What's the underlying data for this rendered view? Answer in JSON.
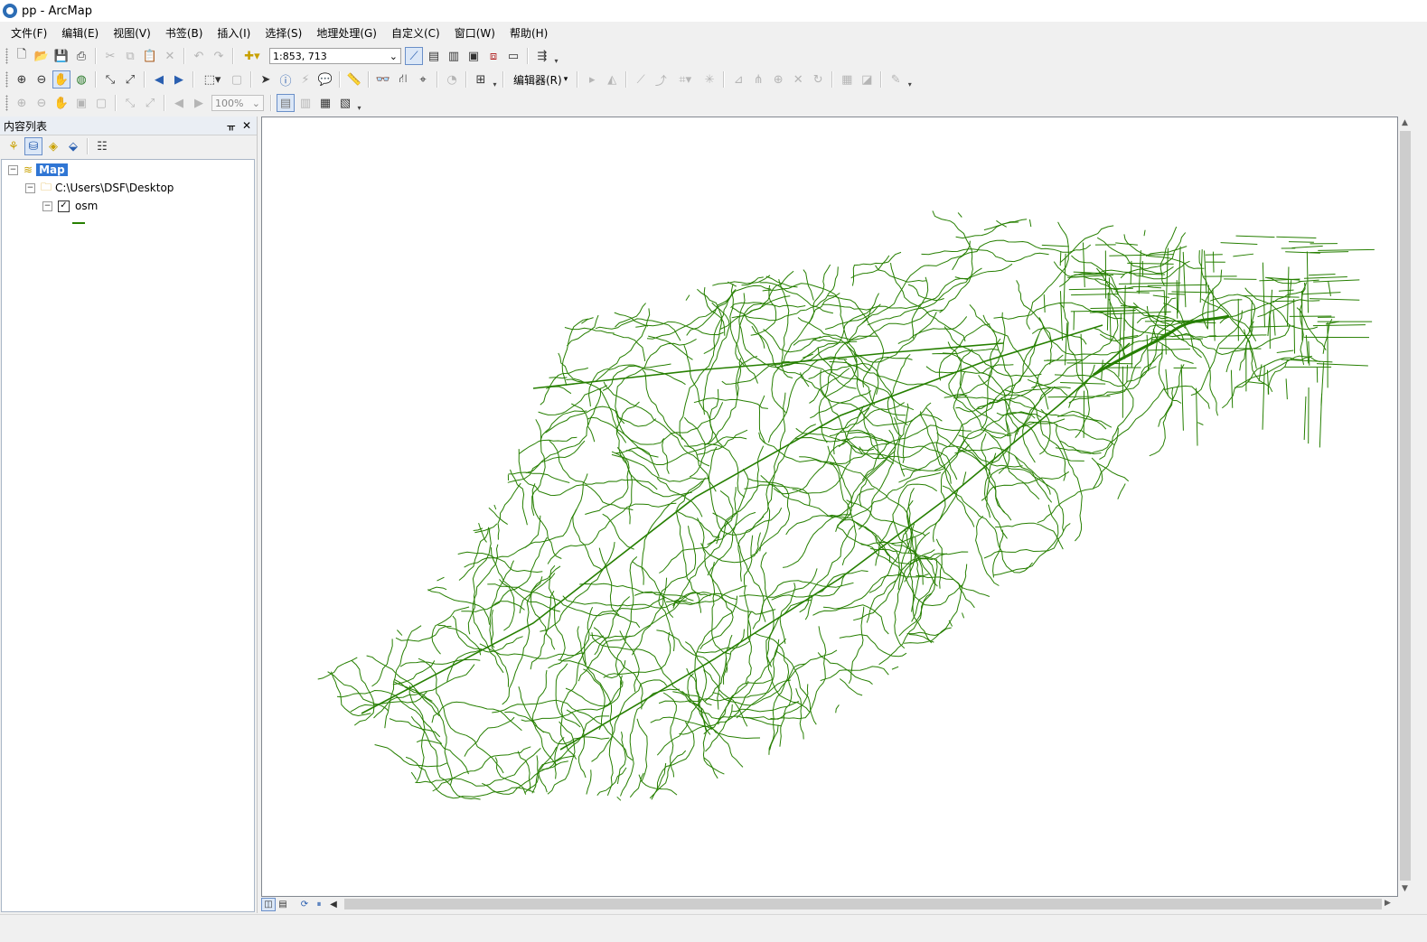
{
  "window": {
    "title": "pp - ArcMap"
  },
  "menu": [
    "文件(F)",
    "编辑(E)",
    "视图(V)",
    "书签(B)",
    "插入(I)",
    "选择(S)",
    "地理处理(G)",
    "自定义(C)",
    "窗口(W)",
    "帮助(H)"
  ],
  "toolbar": {
    "scale_value": "1:853, 713",
    "editor_label": "编辑器(R)",
    "zoom_value": "100%"
  },
  "toc": {
    "title": "内容列表",
    "map_label": "Map",
    "folder_label": "C:\\Users\\DSF\\Desktop",
    "layer_label": "osm",
    "layer_checked": true
  },
  "colors": {
    "road_network": "#267f00",
    "selection": "#3076d4"
  },
  "map": {
    "layer": "osm",
    "content": "road network (line features)"
  }
}
